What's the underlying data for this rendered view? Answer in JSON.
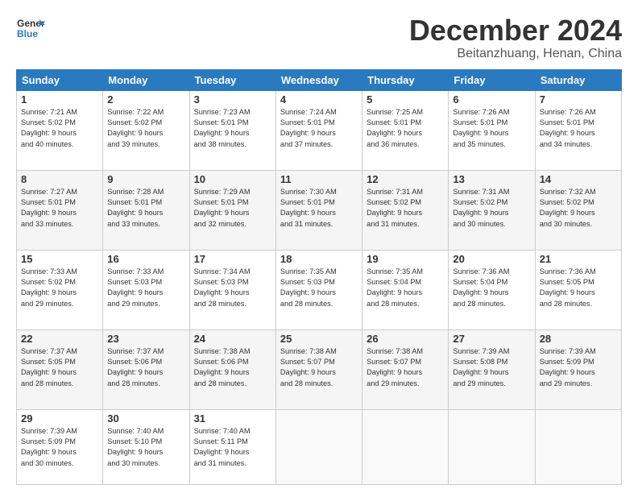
{
  "header": {
    "logo_line1": "General",
    "logo_line2": "Blue",
    "month_title": "December 2024",
    "location": "Beitanzhuang, Henan, China"
  },
  "days_of_week": [
    "Sunday",
    "Monday",
    "Tuesday",
    "Wednesday",
    "Thursday",
    "Friday",
    "Saturday"
  ],
  "weeks": [
    [
      {
        "day": "1",
        "lines": [
          "Sunrise: 7:21 AM",
          "Sunset: 5:02 PM",
          "Daylight: 9 hours",
          "and 40 minutes."
        ]
      },
      {
        "day": "2",
        "lines": [
          "Sunrise: 7:22 AM",
          "Sunset: 5:02 PM",
          "Daylight: 9 hours",
          "and 39 minutes."
        ]
      },
      {
        "day": "3",
        "lines": [
          "Sunrise: 7:23 AM",
          "Sunset: 5:01 PM",
          "Daylight: 9 hours",
          "and 38 minutes."
        ]
      },
      {
        "day": "4",
        "lines": [
          "Sunrise: 7:24 AM",
          "Sunset: 5:01 PM",
          "Daylight: 9 hours",
          "and 37 minutes."
        ]
      },
      {
        "day": "5",
        "lines": [
          "Sunrise: 7:25 AM",
          "Sunset: 5:01 PM",
          "Daylight: 9 hours",
          "and 36 minutes."
        ]
      },
      {
        "day": "6",
        "lines": [
          "Sunrise: 7:26 AM",
          "Sunset: 5:01 PM",
          "Daylight: 9 hours",
          "and 35 minutes."
        ]
      },
      {
        "day": "7",
        "lines": [
          "Sunrise: 7:26 AM",
          "Sunset: 5:01 PM",
          "Daylight: 9 hours",
          "and 34 minutes."
        ]
      }
    ],
    [
      {
        "day": "8",
        "lines": [
          "Sunrise: 7:27 AM",
          "Sunset: 5:01 PM",
          "Daylight: 9 hours",
          "and 33 minutes."
        ]
      },
      {
        "day": "9",
        "lines": [
          "Sunrise: 7:28 AM",
          "Sunset: 5:01 PM",
          "Daylight: 9 hours",
          "and 33 minutes."
        ]
      },
      {
        "day": "10",
        "lines": [
          "Sunrise: 7:29 AM",
          "Sunset: 5:01 PM",
          "Daylight: 9 hours",
          "and 32 minutes."
        ]
      },
      {
        "day": "11",
        "lines": [
          "Sunrise: 7:30 AM",
          "Sunset: 5:01 PM",
          "Daylight: 9 hours",
          "and 31 minutes."
        ]
      },
      {
        "day": "12",
        "lines": [
          "Sunrise: 7:31 AM",
          "Sunset: 5:02 PM",
          "Daylight: 9 hours",
          "and 31 minutes."
        ]
      },
      {
        "day": "13",
        "lines": [
          "Sunrise: 7:31 AM",
          "Sunset: 5:02 PM",
          "Daylight: 9 hours",
          "and 30 minutes."
        ]
      },
      {
        "day": "14",
        "lines": [
          "Sunrise: 7:32 AM",
          "Sunset: 5:02 PM",
          "Daylight: 9 hours",
          "and 30 minutes."
        ]
      }
    ],
    [
      {
        "day": "15",
        "lines": [
          "Sunrise: 7:33 AM",
          "Sunset: 5:02 PM",
          "Daylight: 9 hours",
          "and 29 minutes."
        ]
      },
      {
        "day": "16",
        "lines": [
          "Sunrise: 7:33 AM",
          "Sunset: 5:03 PM",
          "Daylight: 9 hours",
          "and 29 minutes."
        ]
      },
      {
        "day": "17",
        "lines": [
          "Sunrise: 7:34 AM",
          "Sunset: 5:03 PM",
          "Daylight: 9 hours",
          "and 28 minutes."
        ]
      },
      {
        "day": "18",
        "lines": [
          "Sunrise: 7:35 AM",
          "Sunset: 5:03 PM",
          "Daylight: 9 hours",
          "and 28 minutes."
        ]
      },
      {
        "day": "19",
        "lines": [
          "Sunrise: 7:35 AM",
          "Sunset: 5:04 PM",
          "Daylight: 9 hours",
          "and 28 minutes."
        ]
      },
      {
        "day": "20",
        "lines": [
          "Sunrise: 7:36 AM",
          "Sunset: 5:04 PM",
          "Daylight: 9 hours",
          "and 28 minutes."
        ]
      },
      {
        "day": "21",
        "lines": [
          "Sunrise: 7:36 AM",
          "Sunset: 5:05 PM",
          "Daylight: 9 hours",
          "and 28 minutes."
        ]
      }
    ],
    [
      {
        "day": "22",
        "lines": [
          "Sunrise: 7:37 AM",
          "Sunset: 5:05 PM",
          "Daylight: 9 hours",
          "and 28 minutes."
        ]
      },
      {
        "day": "23",
        "lines": [
          "Sunrise: 7:37 AM",
          "Sunset: 5:06 PM",
          "Daylight: 9 hours",
          "and 28 minutes."
        ]
      },
      {
        "day": "24",
        "lines": [
          "Sunrise: 7:38 AM",
          "Sunset: 5:06 PM",
          "Daylight: 9 hours",
          "and 28 minutes."
        ]
      },
      {
        "day": "25",
        "lines": [
          "Sunrise: 7:38 AM",
          "Sunset: 5:07 PM",
          "Daylight: 9 hours",
          "and 28 minutes."
        ]
      },
      {
        "day": "26",
        "lines": [
          "Sunrise: 7:38 AM",
          "Sunset: 5:07 PM",
          "Daylight: 9 hours",
          "and 29 minutes."
        ]
      },
      {
        "day": "27",
        "lines": [
          "Sunrise: 7:39 AM",
          "Sunset: 5:08 PM",
          "Daylight: 9 hours",
          "and 29 minutes."
        ]
      },
      {
        "day": "28",
        "lines": [
          "Sunrise: 7:39 AM",
          "Sunset: 5:09 PM",
          "Daylight: 9 hours",
          "and 29 minutes."
        ]
      }
    ],
    [
      {
        "day": "29",
        "lines": [
          "Sunrise: 7:39 AM",
          "Sunset: 5:09 PM",
          "Daylight: 9 hours",
          "and 30 minutes."
        ]
      },
      {
        "day": "30",
        "lines": [
          "Sunrise: 7:40 AM",
          "Sunset: 5:10 PM",
          "Daylight: 9 hours",
          "and 30 minutes."
        ]
      },
      {
        "day": "31",
        "lines": [
          "Sunrise: 7:40 AM",
          "Sunset: 5:11 PM",
          "Daylight: 9 hours",
          "and 31 minutes."
        ]
      },
      {
        "day": "",
        "lines": []
      },
      {
        "day": "",
        "lines": []
      },
      {
        "day": "",
        "lines": []
      },
      {
        "day": "",
        "lines": []
      }
    ]
  ]
}
